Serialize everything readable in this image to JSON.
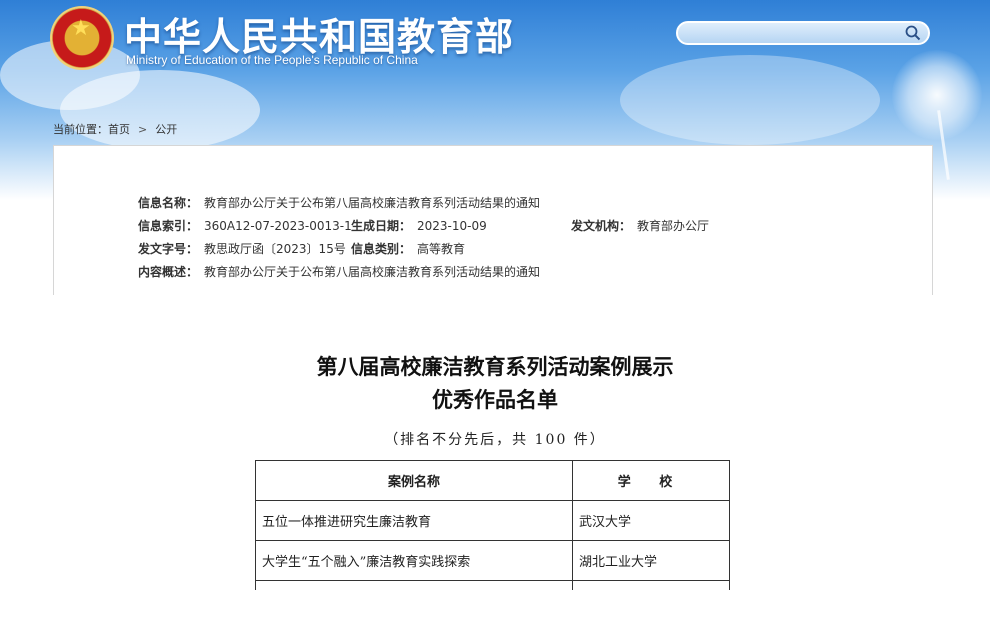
{
  "header": {
    "title_cn": "中华人民共和国教育部",
    "title_en": "Ministry of Education of the People's Republic of China",
    "search_placeholder": ""
  },
  "breadcrumb": {
    "prefix": "当前位置：",
    "items": [
      "首页",
      "公开"
    ],
    "separator": ">"
  },
  "info": {
    "name_label": "信息名称：",
    "name_value": "教育部办公厅关于公布第八届高校廉洁教育系列活动结果的通知",
    "index_label": "信息索引：",
    "index_value": "360A12-07-2023-0013-1",
    "date_label": "生成日期：",
    "date_value": "2023-10-09",
    "org_label": "发文机构：",
    "org_value": "教育部办公厅",
    "docno_label": "发文字号：",
    "docno_value": "教思政厅函〔2023〕15号",
    "category_label": "信息类别：",
    "category_value": "高等教育",
    "summary_label": "内容概述：",
    "summary_value": "教育部办公厅关于公布第八届高校廉洁教育系列活动结果的通知"
  },
  "document": {
    "title_line1": "第八届高校廉洁教育系列活动案例展示",
    "title_line2": "优秀作品名单",
    "subtitle": "（排名不分先后，共 100 件）"
  },
  "table": {
    "headers": [
      "案例名称",
      "学 校"
    ],
    "rows": [
      [
        "五位一体推进研究生廉洁教育",
        "武汉大学"
      ],
      [
        "大学生“五个融入”廉洁教育实践探索",
        "湖北工业大学"
      ]
    ]
  },
  "colors": {
    "banner_top": "#2f7fd6",
    "emblem_red": "#c61a1a",
    "emblem_gold": "#e3b134"
  },
  "icons": {
    "search": "magnifier-icon",
    "emblem": "national-emblem-icon"
  }
}
